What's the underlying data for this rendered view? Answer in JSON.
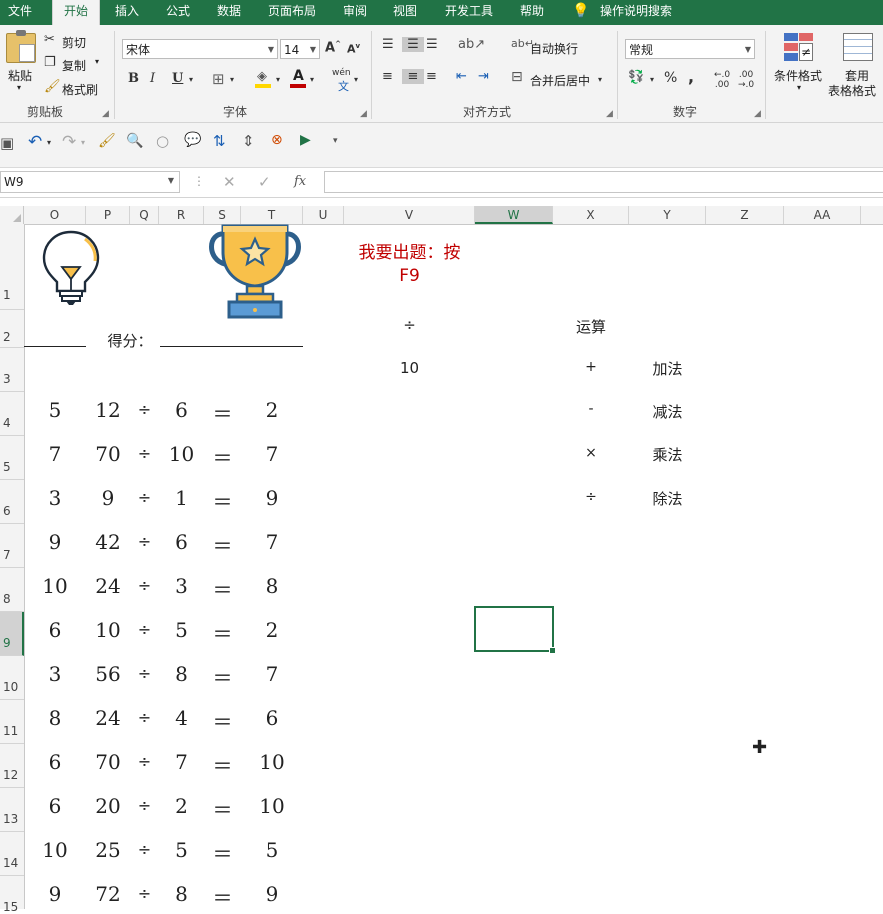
{
  "menu": {
    "tabs": [
      "文件",
      "开始",
      "插入",
      "公式",
      "数据",
      "页面布局",
      "审阅",
      "视图",
      "开发工具",
      "帮助"
    ],
    "active": "开始",
    "search_label": "操作说明搜索"
  },
  "ribbon": {
    "clipboard": {
      "paste": "粘贴",
      "cut": "剪切",
      "copy": "复制",
      "format_painter": "格式刷",
      "label": "剪贴板"
    },
    "font": {
      "name": "宋体",
      "size": "14",
      "label": "字体",
      "bold": "B",
      "italic": "I",
      "underline": "U",
      "wen": "wén"
    },
    "alignment": {
      "wrap": "自动换行",
      "merge": "合并后居中",
      "label": "对齐方式"
    },
    "number": {
      "format": "常规",
      "percent": "%",
      "comma": ",",
      "label": "数字"
    },
    "styles": {
      "conditional": "条件格式",
      "table1": "套用",
      "table2": "表格格式"
    }
  },
  "formula_bar": {
    "name_box": "W9",
    "formula": "",
    "fx": "fx"
  },
  "columns": [
    "O",
    "P",
    "Q",
    "R",
    "S",
    "T",
    "U",
    "V",
    "W",
    "X",
    "Y",
    "Z",
    "AA"
  ],
  "selected_column": "W",
  "rows": [
    "1",
    "2",
    "3",
    "4",
    "5",
    "6",
    "7",
    "8",
    "9",
    "10",
    "11",
    "12",
    "13",
    "14",
    "15"
  ],
  "selected_row": "9",
  "sheet": {
    "prompt_line1": "我要出题：按",
    "prompt_line2": "F9",
    "score_label": "得分：",
    "current_op": "÷",
    "op_header": "运算",
    "max_value": "10",
    "operations": [
      {
        "symbol": "+",
        "name": "加法"
      },
      {
        "symbol": "-",
        "name": "减法"
      },
      {
        "symbol": "×",
        "name": "乘法"
      },
      {
        "symbol": "÷",
        "name": "除法"
      }
    ],
    "problems": [
      {
        "n": "5",
        "a": "12",
        "op": "÷",
        "b": "6",
        "eq": "＝",
        "ans": "2"
      },
      {
        "n": "7",
        "a": "70",
        "op": "÷",
        "b": "10",
        "eq": "＝",
        "ans": "7"
      },
      {
        "n": "3",
        "a": "9",
        "op": "÷",
        "b": "1",
        "eq": "＝",
        "ans": "9"
      },
      {
        "n": "9",
        "a": "42",
        "op": "÷",
        "b": "6",
        "eq": "＝",
        "ans": "7"
      },
      {
        "n": "10",
        "a": "24",
        "op": "÷",
        "b": "3",
        "eq": "＝",
        "ans": "8"
      },
      {
        "n": "6",
        "a": "10",
        "op": "÷",
        "b": "5",
        "eq": "＝",
        "ans": "2"
      },
      {
        "n": "3",
        "a": "56",
        "op": "÷",
        "b": "8",
        "eq": "＝",
        "ans": "7"
      },
      {
        "n": "8",
        "a": "24",
        "op": "÷",
        "b": "4",
        "eq": "＝",
        "ans": "6"
      },
      {
        "n": "6",
        "a": "70",
        "op": "÷",
        "b": "7",
        "eq": "＝",
        "ans": "10"
      },
      {
        "n": "6",
        "a": "20",
        "op": "÷",
        "b": "2",
        "eq": "＝",
        "ans": "10"
      },
      {
        "n": "10",
        "a": "25",
        "op": "÷",
        "b": "5",
        "eq": "＝",
        "ans": "5"
      },
      {
        "n": "9",
        "a": "72",
        "op": "÷",
        "b": "8",
        "eq": "＝",
        "ans": "9"
      }
    ]
  },
  "colors": {
    "excel_green": "#217346",
    "prompt_red": "#c00000",
    "trophy_gold": "#f8c04a",
    "trophy_blue": "#2d5f8b"
  }
}
